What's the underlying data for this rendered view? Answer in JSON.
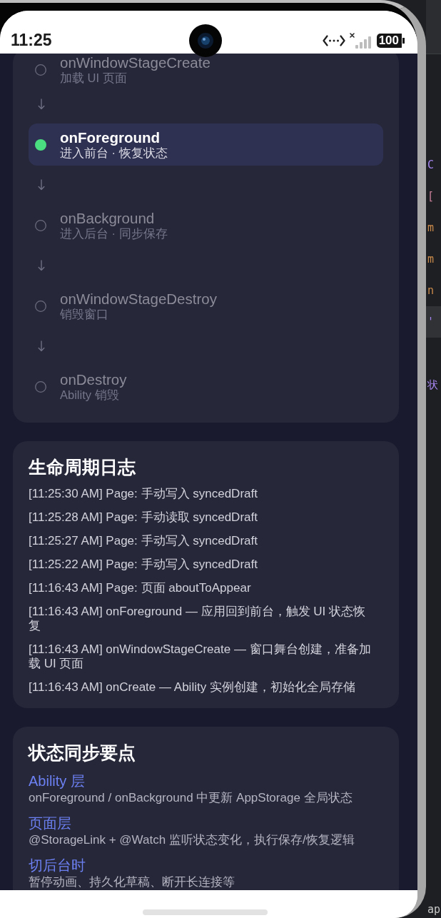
{
  "status_bar": {
    "time": "11:25",
    "battery": "100"
  },
  "lifecycle": {
    "steps": [
      {
        "name": "onWindowStageCreate",
        "description": "加载 UI 页面",
        "current": false
      },
      {
        "name": "onForeground",
        "description": "进入前台 · 恢复状态",
        "current": true
      },
      {
        "name": "onBackground",
        "description": "进入后台 · 同步保存",
        "current": false
      },
      {
        "name": "onWindowStageDestroy",
        "description": "销毁窗口",
        "current": false
      },
      {
        "name": "onDestroy",
        "description": "Ability 销毁",
        "current": false
      }
    ]
  },
  "log": {
    "title": "生命周期日志",
    "entries": [
      "[11:25:30 AM] Page: 手动写入 syncedDraft",
      "[11:25:28 AM] Page: 手动读取 syncedDraft",
      "[11:25:27 AM] Page: 手动写入 syncedDraft",
      "[11:25:22 AM] Page: 手动写入 syncedDraft",
      "[11:16:43 AM] Page: 页面 aboutToAppear",
      "[11:16:43 AM] onForeground — 应用回到前台，触发 UI 状态恢复",
      "[11:16:43 AM] onWindowStageCreate — 窗口舞台创建，准备加载 UI 页面",
      "[11:16:43 AM] onCreate — Ability 实例创建，初始化全局存储"
    ]
  },
  "sync_points": {
    "title": "状态同步要点",
    "items": [
      {
        "heading": "Ability 层",
        "detail": "onForeground / onBackground 中更新 AppStorage 全局状态"
      },
      {
        "heading": "页面层",
        "detail": "@StorageLink + @Watch 监听状态变化，执行保存/恢复逻辑"
      },
      {
        "heading": "切后台时",
        "detail": "暂停动画、持久化草稿、断开长连接等"
      }
    ]
  },
  "code_editor": {
    "fragments": [
      {
        "text": "C",
        "color": "#a586f0",
        "current": false
      },
      {
        "text": "[",
        "color": "#c97f98",
        "current": false
      },
      {
        "text": "m",
        "color": "#c98a4b",
        "current": false
      },
      {
        "text": "m",
        "color": "#c98a4b",
        "current": false
      },
      {
        "text": "n",
        "color": "#c98a4b",
        "current": false
      },
      {
        "text": "'",
        "color": "#a586f0",
        "current": true
      },
      {
        "text": "状",
        "color": "#a586f0",
        "current": false
      },
      {
        "text": "ap",
        "color": "#c8c8c8",
        "current": false
      }
    ]
  }
}
